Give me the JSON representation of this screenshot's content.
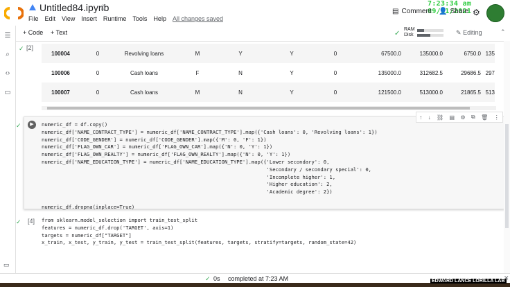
{
  "header": {
    "title": "Untitled84.ipynb",
    "menu": [
      "File",
      "Edit",
      "View",
      "Insert",
      "Runtime",
      "Tools",
      "Help"
    ],
    "saved_status": "All changes saved",
    "clock": "7:23:34 am 09/11/2021",
    "comment_label": "Comment",
    "share_label": "Share"
  },
  "toolbar": {
    "add_code": "+ Code",
    "add_text": "+ Text",
    "ram_label": "RAM",
    "disk_label": "Disk",
    "ram_fraction": 0.25,
    "disk_fraction": 0.5,
    "editing_label": "Editing"
  },
  "output_cell": {
    "label": "[2]",
    "rows": [
      [
        "100004",
        "0",
        "Revolving loans",
        "M",
        "Y",
        "Y",
        "0",
        "67500.0",
        "135000.0",
        "6750.0",
        "135"
      ],
      [
        "100006",
        "0",
        "Cash loans",
        "F",
        "N",
        "Y",
        "0",
        "135000.0",
        "312682.5",
        "29686.5",
        "297"
      ],
      [
        "100007",
        "0",
        "Cash loans",
        "M",
        "N",
        "Y",
        "0",
        "121500.0",
        "513000.0",
        "21865.5",
        "513"
      ]
    ]
  },
  "code_cell_1": {
    "lines": [
      "numeric_df = df.copy()",
      "numeric_df['NAME_CONTRACT_TYPE'] = numeric_df['NAME_CONTRACT_TYPE'].map({'Cash loans': 0, 'Revolving loans': 1})",
      "numeric_df['CODE_GENDER'] = numeric_df['CODE_GENDER'].map({'M': 0, 'F': 1})",
      "numeric_df['FLAG_OWN_CAR'] = numeric_df['FLAG_OWN_CAR'].map({'N': 0, 'Y': 1})",
      "numeric_df['FLAG_OWN_REALTY'] = numeric_df['FLAG_OWN_REALTY'].map({'N': 0, 'Y': 1})",
      "numeric_df['NAME_EDUCATION_TYPE'] = numeric_df['NAME_EDUCATION_TYPE'].map({'Lower secondary': 0,",
      "                                                                           'Secondary / secondary special': 0,",
      "                                                                           'Incomplete higher': 1,",
      "                                                                           'Higher education': 2,",
      "                                                                           'Academic degree': 2})",
      "",
      "numeric_df.dropna(inplace=True)"
    ]
  },
  "code_cell_2": {
    "label": "[4]",
    "lines": [
      "from sklearn.model_selection import train_test_split",
      "features = numeric_df.drop('TARGET', axis=1)",
      "targets = numeric_df[\"TARGET\"]",
      "x_train, x_test, y_train, y_test = train_test_split(features, targets, stratify=targets, random_state=42)"
    ]
  },
  "statusbar": {
    "exec_time": "0s",
    "completed": "completed at 7:23 AM"
  },
  "watermark": "EDWARD LANCE LORILLA LAB",
  "colors": {
    "accent_green": "#34a853",
    "clock_green": "#2ecc40",
    "logo_orange": "#f9ab00"
  }
}
